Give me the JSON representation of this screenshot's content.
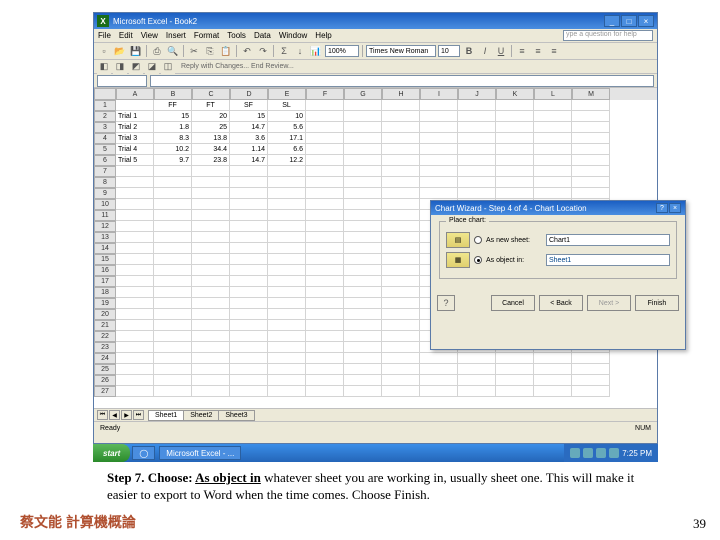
{
  "window": {
    "title": "Microsoft Excel - Book2",
    "help_placeholder": "ype a question for help"
  },
  "menu": [
    "File",
    "Edit",
    "View",
    "Insert",
    "Format",
    "Tools",
    "Data",
    "Window",
    "Help"
  ],
  "toolbar": {
    "zoom": "100%",
    "font": "Times New Roman",
    "font_size": "10",
    "review": "Reply with Changes... End Review..."
  },
  "sheet": {
    "col_headers": [
      "A",
      "B",
      "C",
      "D",
      "E",
      "F",
      "G",
      "H",
      "I",
      "J",
      "K",
      "L",
      "M"
    ],
    "header_row": [
      "",
      "FF",
      "FT",
      "SF",
      "SL"
    ],
    "rows": [
      {
        "n": 1,
        "c": [
          "",
          "FF",
          "FT",
          "SF",
          "SL"
        ]
      },
      {
        "n": 2,
        "c": [
          "Trial 1",
          "15",
          "20",
          "15",
          "10"
        ]
      },
      {
        "n": 3,
        "c": [
          "Trial 2",
          "1.8",
          "25",
          "14.7",
          "5.6"
        ]
      },
      {
        "n": 4,
        "c": [
          "Trial 3",
          "8.3",
          "13.8",
          "3.6",
          "17.1"
        ]
      },
      {
        "n": 5,
        "c": [
          "Trial 4",
          "10.2",
          "34.4",
          "1.14",
          "6.6"
        ]
      },
      {
        "n": 6,
        "c": [
          "Trial 5",
          "9.7",
          "23.8",
          "14.7",
          "12.2"
        ]
      }
    ],
    "visible_rows": 27,
    "tabs": [
      "Sheet1",
      "Sheet2",
      "Sheet3"
    ]
  },
  "chart_data": {
    "type": "table",
    "categories": [
      "FF",
      "FT",
      "SF",
      "SL"
    ],
    "series": [
      {
        "name": "Trial 1",
        "values": [
          15,
          20,
          15,
          10
        ]
      },
      {
        "name": "Trial 2",
        "values": [
          1.8,
          25,
          14.7,
          5.6
        ]
      },
      {
        "name": "Trial 3",
        "values": [
          8.3,
          13.8,
          3.6,
          17.1
        ]
      },
      {
        "name": "Trial 4",
        "values": [
          10.2,
          34.4,
          1.14,
          6.6
        ]
      },
      {
        "name": "Trial 5",
        "values": [
          9.7,
          23.8,
          14.7,
          12.2
        ]
      }
    ]
  },
  "dialog": {
    "title": "Chart Wizard - Step 4 of 4 - Chart Location",
    "group": "Place chart:",
    "opt_new": "As new sheet:",
    "opt_new_val": "Chart1",
    "opt_obj": "As object in:",
    "opt_obj_val": "Sheet1",
    "buttons": {
      "cancel": "Cancel",
      "back": "< Back",
      "next": "Next >",
      "finish": "Finish"
    }
  },
  "status": {
    "ready": "Ready",
    "num": "NUM"
  },
  "taskbar": {
    "start": "start",
    "app": "Microsoft Excel - ...",
    "clock": "7:25 PM"
  },
  "caption": {
    "bold": "Step 7. Choose: ",
    "u": "As object in",
    "rest": " whatever sheet you are working in, usually sheet one. This will make it easier to export to Word when the time comes. Choose Finish."
  },
  "footer_cn": "蔡文能 計算機概論",
  "page_num": "39"
}
